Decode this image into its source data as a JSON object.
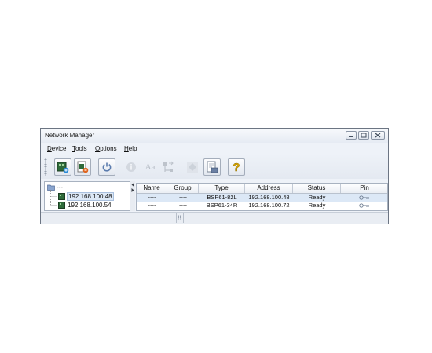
{
  "window": {
    "title": "Network Manager"
  },
  "menu": {
    "items": [
      "Device",
      "Tools",
      "Options",
      "Help"
    ]
  },
  "toolbar": {
    "buttons": [
      {
        "icon": "device-add-icon"
      },
      {
        "icon": "device-remove-icon"
      },
      {
        "icon": "power-icon"
      },
      {
        "icon": "info-icon"
      },
      {
        "icon": "font-icon",
        "label": "Aa"
      },
      {
        "icon": "network-tree-icon"
      },
      {
        "icon": "diamond-icon"
      },
      {
        "icon": "export-icon"
      },
      {
        "icon": "help-icon",
        "label": "?"
      }
    ]
  },
  "tree": {
    "root_label": "---",
    "children": [
      "192.168.100.48",
      "192.168.100.54"
    ]
  },
  "table": {
    "columns": [
      "Name",
      "Group",
      "Type",
      "Address",
      "Status",
      "Pin"
    ],
    "rows": [
      {
        "name": "----",
        "group": "----",
        "type": "BSP61-82L",
        "address": "192.168.100.48",
        "status": "Ready",
        "pin_icon": "key-icon"
      },
      {
        "name": "----",
        "group": "----",
        "type": "BSP61-34R",
        "address": "192.168.100.72",
        "status": "Ready",
        "pin_icon": "key-icon"
      }
    ]
  },
  "colors": {
    "selected_row": "#dce8f6",
    "window_bg": "#eef2f8"
  }
}
